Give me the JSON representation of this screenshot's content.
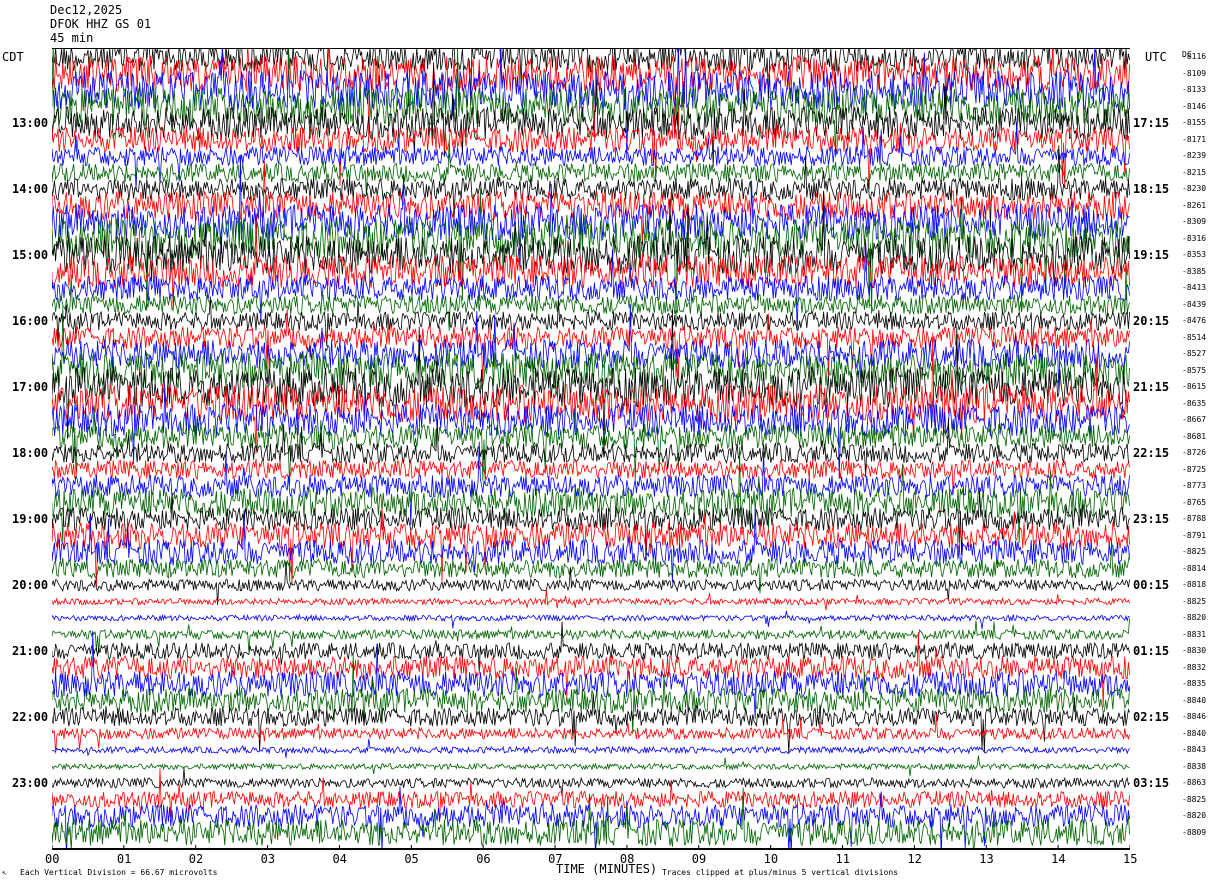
{
  "header": {
    "date": "Dec12,2025",
    "station": "DFOK HHZ GS 01",
    "extra": "45 min"
  },
  "axes": {
    "left_tz": "CDT",
    "right_tz": "UTC",
    "right_header": "DC",
    "x_title": "TIME (MINUTES)",
    "x_ticks": [
      "00",
      "01",
      "02",
      "03",
      "04",
      "05",
      "06",
      "07",
      "08",
      "09",
      "10",
      "11",
      "12",
      "13",
      "14",
      "15"
    ]
  },
  "hour_labels": {
    "left": [
      "13:00",
      "14:00",
      "15:00",
      "16:00",
      "17:00",
      "18:00",
      "19:00",
      "20:00",
      "21:00",
      "22:00",
      "23:00"
    ],
    "right": [
      "17:15",
      "18:15",
      "19:15",
      "20:15",
      "21:15",
      "22:15",
      "23:15",
      "00:15",
      "01:15",
      "02:15",
      "03:15"
    ]
  },
  "dc_offsets": [
    "-8116",
    "-8109",
    "-8133",
    "-8146",
    "-8155",
    "-8171",
    "-8239",
    "-8215",
    "-8230",
    "-8261",
    "-8309",
    "-8316",
    "-8353",
    "-8385",
    "-8413",
    "-8439",
    "-8476",
    "-8514",
    "-8527",
    "-8575",
    "-8615",
    "-8635",
    "-8667",
    "-8681",
    "-8726",
    "-8725",
    "-8773",
    "-8765",
    "-8788",
    "-8791",
    "-8825",
    "-8814",
    "-8818",
    "-8825",
    "-8820",
    "-8831",
    "-8830",
    "-8832",
    "-8835",
    "-8840",
    "-8846",
    "-8840",
    "-8843",
    "-8838",
    "-8863",
    "-8825",
    "-8820",
    "-8809"
  ],
  "footer": {
    "scale": "Each Vertical Division =    66.67 microvolts",
    "clip": "Traces clipped at plus/minus 5 vertical divisions"
  },
  "trace_colors": [
    "#000000",
    "#ff0000",
    "#0000ff",
    "#006400"
  ]
}
